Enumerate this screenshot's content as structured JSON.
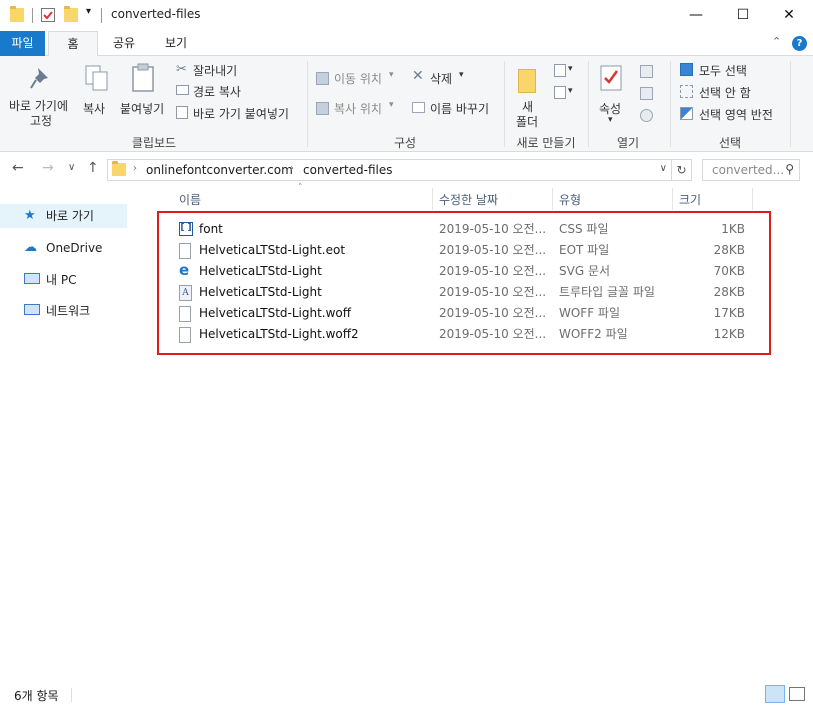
{
  "window": {
    "title": "converted-files",
    "controls": {
      "minimize": "—",
      "maximize": "☐",
      "close": "✕"
    }
  },
  "ribbon_tabs": [
    "파일",
    "홈",
    "공유",
    "보기"
  ],
  "ribbon": {
    "clipboard": {
      "pin_line1": "바로 가기에",
      "pin_line2": "고정",
      "copy": "복사",
      "paste": "붙여넣기",
      "cut": "잘라내기",
      "copy_path": "경로 복사",
      "paste_shortcut": "바로 가기 붙여넣기",
      "label": "클립보드"
    },
    "organize": {
      "move_to": "이동 위치",
      "delete": "삭제",
      "copy_to": "복사 위치",
      "rename": "이름 바꾸기",
      "label": "구성"
    },
    "new": {
      "new_folder_line1": "새",
      "new_folder_line2": "폴더",
      "label": "새로 만들기"
    },
    "open": {
      "properties": "속성",
      "label": "열기"
    },
    "select": {
      "select_all": "모두 선택",
      "select_none": "선택 안 함",
      "invert": "선택 영역 반전",
      "label": "선택"
    }
  },
  "address": {
    "crumbs": [
      "onlinefontconverter.com",
      "converted-files"
    ],
    "search_placeholder": "converted..."
  },
  "nav_pane": [
    {
      "label": "바로 가기",
      "icon": "star-icon"
    },
    {
      "label": "OneDrive",
      "icon": "cloud-icon"
    },
    {
      "label": "내 PC",
      "icon": "computer-icon"
    },
    {
      "label": "네트워크",
      "icon": "network-icon"
    }
  ],
  "columns": [
    "이름",
    "수정한 날짜",
    "유형",
    "크기"
  ],
  "files": [
    {
      "name": "font",
      "date": "2019-05-10 오전...",
      "type": "CSS 파일",
      "size": "1KB",
      "icon": "css-file-icon"
    },
    {
      "name": "HelveticaLTStd-Light.eot",
      "date": "2019-05-10 오전...",
      "type": "EOT 파일",
      "size": "28KB",
      "icon": "file-icon"
    },
    {
      "name": "HelveticaLTStd-Light",
      "date": "2019-05-10 오전...",
      "type": "SVG 문서",
      "size": "70KB",
      "icon": "ie-icon"
    },
    {
      "name": "HelveticaLTStd-Light",
      "date": "2019-05-10 오전...",
      "type": "트루타입 글꼴 파일",
      "size": "28KB",
      "icon": "font-file-icon"
    },
    {
      "name": "HelveticaLTStd-Light.woff",
      "date": "2019-05-10 오전...",
      "type": "WOFF 파일",
      "size": "17KB",
      "icon": "file-icon"
    },
    {
      "name": "HelveticaLTStd-Light.woff2",
      "date": "2019-05-10 오전...",
      "type": "WOFF2 파일",
      "size": "12KB",
      "icon": "file-icon"
    }
  ],
  "status": {
    "count": "6개 항목"
  },
  "colors": {
    "accent": "#1979ca",
    "highlight": "#e01b1b",
    "folder": "#f8d66b"
  }
}
